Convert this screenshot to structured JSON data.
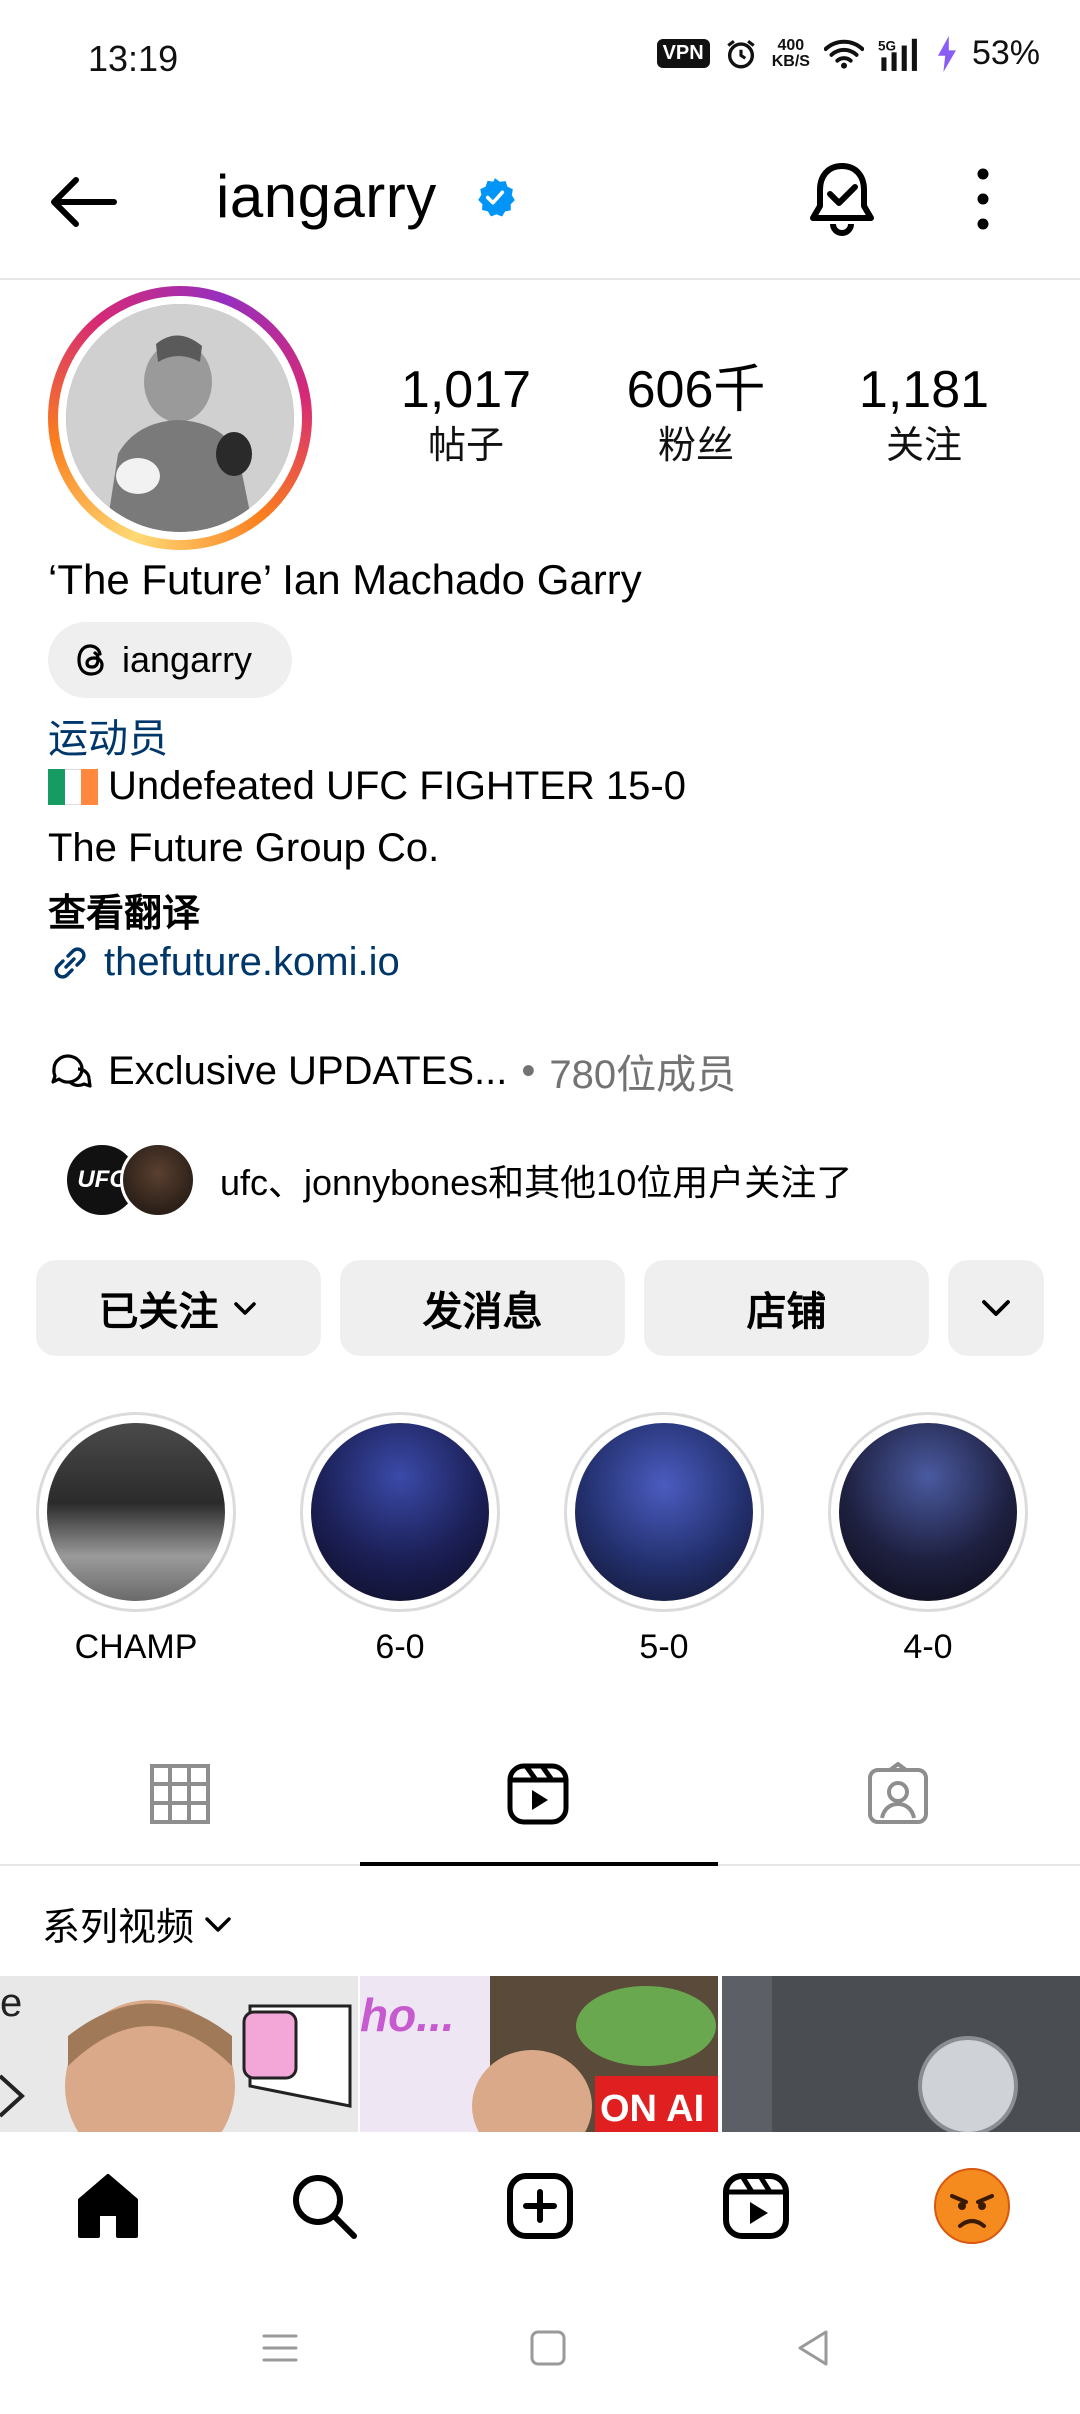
{
  "status_bar": {
    "time": "13:19",
    "vpn": "VPN",
    "speed_value": "400",
    "speed_unit": "KB/S",
    "battery": "53%"
  },
  "header": {
    "username": "iangarry"
  },
  "stats": [
    {
      "value": "1,017",
      "label": "帖子"
    },
    {
      "value": "606千",
      "label": "粉丝"
    },
    {
      "value": "1,181",
      "label": "关注"
    }
  ],
  "profile": {
    "full_name": "‘The Future’ Ian Machado Garry",
    "threads_handle": "iangarry",
    "category": "运动员",
    "bio_line1": "Undefeated UFC FIGHTER 15-0",
    "bio_line2": "The Future Group Co.",
    "translate": "查看翻译",
    "link": "thefuture.komi.io"
  },
  "channel": {
    "title": "Exclusive UPDATES...",
    "separator": "•",
    "members": "780位成员"
  },
  "followed_by": {
    "badge": "UFC",
    "text": "ufc、jonnybones和其他10位用户关注了"
  },
  "actions": {
    "following": "已关注",
    "message": "发消息",
    "shop": "店铺"
  },
  "highlights": [
    {
      "label": "CHAMP"
    },
    {
      "label": "6-0"
    },
    {
      "label": "5-0"
    },
    {
      "label": "4-0"
    }
  ],
  "series_label": "系列视频",
  "thumbnails": {
    "t1_text": "e",
    "t2_text": "ho...",
    "t2_sign": "ON AI"
  },
  "colors": {
    "link": "#00376b",
    "verified": "#0095f6",
    "button_bg": "#efefef"
  }
}
